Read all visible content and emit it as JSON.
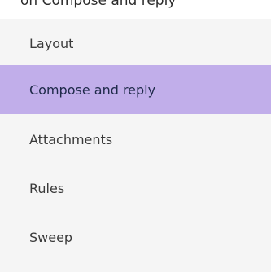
{
  "header": {
    "partial_title": "on Compose and reply"
  },
  "nav": {
    "items": [
      {
        "label": "Layout"
      },
      {
        "label": "Compose and reply",
        "selected": true
      },
      {
        "label": "Attachments"
      },
      {
        "label": "Rules"
      },
      {
        "label": "Sweep"
      }
    ]
  },
  "colors": {
    "selected_bg": "#c1aeea",
    "panel_bg": "#f5f5f5"
  }
}
